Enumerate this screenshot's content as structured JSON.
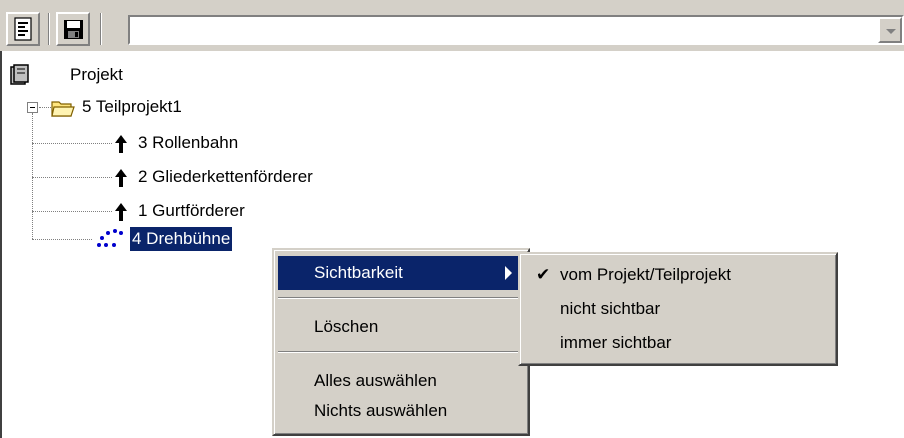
{
  "toolbar": {
    "buttons": [
      {
        "name": "properties-list-icon"
      },
      {
        "name": "save-disk-icon"
      }
    ],
    "combo_value": ""
  },
  "tree": {
    "root": {
      "label": "Projekt",
      "icon": "project-books-icon"
    },
    "folder": {
      "label": "5  Teilprojekt1",
      "icon": "folder-open-icon",
      "expander": "minus"
    },
    "children": [
      {
        "label": "3  Rollenbahn",
        "icon": "up-arrow-icon"
      },
      {
        "label": "2  Gliederkettenförderer",
        "icon": "up-arrow-icon"
      },
      {
        "label": "1  Gurtförderer",
        "icon": "up-arrow-icon"
      },
      {
        "label": "4  Drehbühne",
        "icon": "dotted-rotate-icon",
        "selected": true
      }
    ]
  },
  "context_menu": {
    "items": [
      {
        "label": "Sichtbarkeit",
        "submenu": true,
        "highlighted": true
      },
      {
        "label": "Löschen"
      },
      {
        "label": "Alles auswählen"
      },
      {
        "label": "Nichts auswählen"
      }
    ]
  },
  "submenu": {
    "items": [
      {
        "label": "vom Projekt/Teilprojekt",
        "checked": true
      },
      {
        "label": "nicht sichtbar"
      },
      {
        "label": "immer sichtbar"
      }
    ]
  },
  "colors": {
    "selection": "#0a246a",
    "face": "#d4d0c8"
  }
}
